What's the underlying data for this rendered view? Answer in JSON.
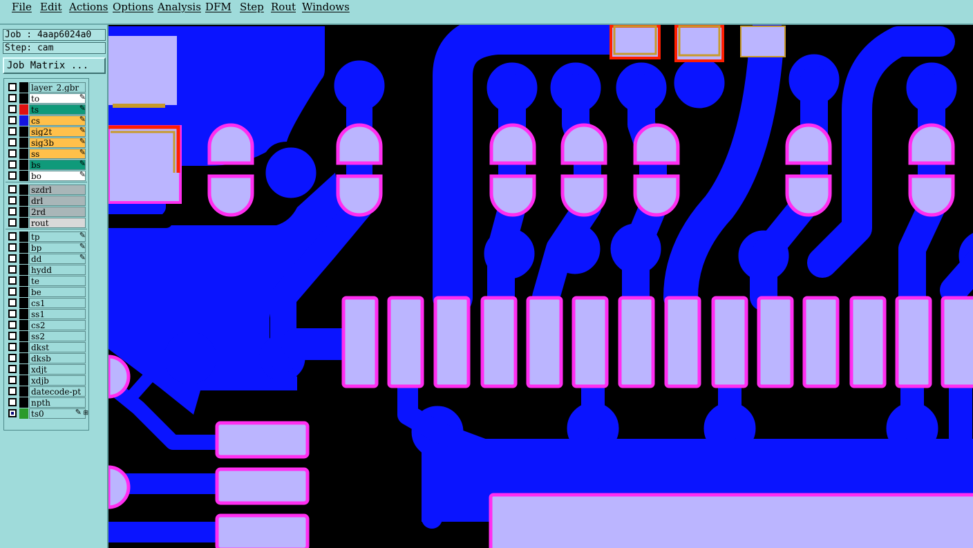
{
  "menu": {
    "items": [
      "File",
      "Edit",
      "Actions",
      "Options",
      "Analysis",
      "DFM",
      "Step",
      "Rout",
      "Windows"
    ]
  },
  "job_panel": {
    "job_label": "Job : 4aap6024a0",
    "step_label": "Step: cam",
    "job_matrix_button": "Job Matrix ..."
  },
  "layers": [
    {
      "name": "layer_2.gbr",
      "color": "#9fdbda",
      "swatch": "#000000",
      "editable": false
    },
    {
      "name": "to",
      "color": "#ffffff",
      "swatch": "#000000",
      "editable": true
    },
    {
      "name": "ts",
      "color": "#0f9a7a",
      "swatch": "#e01010",
      "editable": true
    },
    {
      "name": "cs",
      "color": "#ffc04a",
      "swatch": "#1414e0",
      "editable": true
    },
    {
      "name": "sig2t",
      "color": "#ffc04a",
      "swatch": "#000000",
      "editable": true
    },
    {
      "name": "sig3b",
      "color": "#ffc04a",
      "swatch": "#000000",
      "editable": true
    },
    {
      "name": "ss",
      "color": "#ffc04a",
      "swatch": "#000000",
      "editable": true
    },
    {
      "name": "bs",
      "color": "#0f9a7a",
      "swatch": "#000000",
      "editable": true
    },
    {
      "name": "bo",
      "color": "#ffffff",
      "swatch": "#000000",
      "editable": true
    },
    {
      "name": "szdrl",
      "color": "#a9b6b8",
      "swatch": "#000000",
      "editable": false
    },
    {
      "name": "drl",
      "color": "#a9b6b8",
      "swatch": "#000000",
      "editable": false
    },
    {
      "name": "2rd",
      "color": "#a9b6b8",
      "swatch": "#000000",
      "editable": false
    },
    {
      "name": "rout",
      "color": "#d9d9d9",
      "swatch": "#000000",
      "editable": false
    },
    {
      "name": "tp",
      "color": "#9fdbda",
      "swatch": "#000000",
      "editable": true
    },
    {
      "name": "bp",
      "color": "#9fdbda",
      "swatch": "#000000",
      "editable": true
    },
    {
      "name": "dd",
      "color": "#9fdbda",
      "swatch": "#000000",
      "editable": true
    },
    {
      "name": "hydd",
      "color": "#9fdbda",
      "swatch": "#000000",
      "editable": false
    },
    {
      "name": "te",
      "color": "#9fdbda",
      "swatch": "#000000",
      "editable": false
    },
    {
      "name": "be",
      "color": "#9fdbda",
      "swatch": "#000000",
      "editable": false
    },
    {
      "name": "cs1",
      "color": "#9fdbda",
      "swatch": "#000000",
      "editable": false
    },
    {
      "name": "ss1",
      "color": "#9fdbda",
      "swatch": "#000000",
      "editable": false
    },
    {
      "name": "cs2",
      "color": "#9fdbda",
      "swatch": "#000000",
      "editable": false
    },
    {
      "name": "ss2",
      "color": "#9fdbda",
      "swatch": "#000000",
      "editable": false
    },
    {
      "name": "dkst",
      "color": "#9fdbda",
      "swatch": "#000000",
      "editable": false
    },
    {
      "name": "dksb",
      "color": "#9fdbda",
      "swatch": "#000000",
      "editable": false
    },
    {
      "name": "xdjt",
      "color": "#9fdbda",
      "swatch": "#000000",
      "editable": false
    },
    {
      "name": "xdjb",
      "color": "#9fdbda",
      "swatch": "#000000",
      "editable": false
    },
    {
      "name": "datecode-pt",
      "color": "#9fdbda",
      "swatch": "#000000",
      "editable": false
    },
    {
      "name": "npth",
      "color": "#9fdbda",
      "swatch": "#000000",
      "editable": false
    },
    {
      "name": "ts0",
      "color": "#9fdbda",
      "swatch": "#2a9a2a",
      "editable": true,
      "marked": true
    }
  ],
  "glyphs": {
    "edit_icon": "✎",
    "mark_icon": "⊞"
  },
  "colors": {
    "copper": "#0a14ff",
    "pad_fill": "#bbb5ff",
    "pad_edge": "#ff2ef0",
    "red_outline": "#ff1e00",
    "gold_outline": "#c89a2a",
    "background": "#000000",
    "panel": "#9fdbda"
  }
}
